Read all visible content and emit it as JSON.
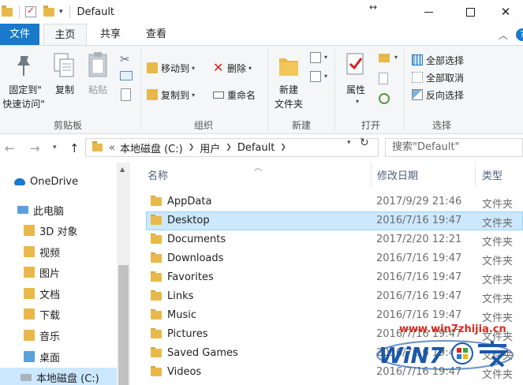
{
  "window": {
    "title": "Default",
    "resize_glyph": "↔",
    "close_glyph": "✕"
  },
  "tabs": {
    "file": "文件",
    "home": "主页",
    "share": "共享",
    "view": "查看",
    "collapse_glyph": "︿",
    "help": "?"
  },
  "ribbon": {
    "clipboard": {
      "label": "剪贴板",
      "pin_line1": "固定到\"",
      "pin_line2": "快速访问\"",
      "copy": "复制",
      "paste": "粘贴"
    },
    "organize": {
      "label": "组织",
      "move_to": "移动到",
      "copy_to": "复制到",
      "delete": "删除",
      "rename": "重命名"
    },
    "new": {
      "label": "新建",
      "new_folder_line1": "新建",
      "new_folder_line2": "文件夹"
    },
    "open": {
      "label": "打开",
      "properties": "属性"
    },
    "select": {
      "label": "选择",
      "select_all": "全部选择",
      "select_none": "全部取消",
      "invert": "反向选择"
    }
  },
  "address": {
    "prefix": "«",
    "crumbs": [
      "本地磁盘 (C:)",
      "用户",
      "Default"
    ],
    "search_placeholder": "搜索\"Default\""
  },
  "nav": {
    "items": [
      {
        "label": "OneDrive",
        "icon": "cloud-icon"
      },
      {
        "label": "此电脑",
        "icon": "computer-icon"
      },
      {
        "label": "3D 对象",
        "icon": "3d-objects-icon"
      },
      {
        "label": "视频",
        "icon": "video-icon"
      },
      {
        "label": "图片",
        "icon": "pictures-icon"
      },
      {
        "label": "文档",
        "icon": "documents-icon"
      },
      {
        "label": "下载",
        "icon": "download-icon"
      },
      {
        "label": "音乐",
        "icon": "music-icon"
      },
      {
        "label": "桌面",
        "icon": "desktop-icon"
      },
      {
        "label": "本地磁盘 (C:)",
        "icon": "drive-icon"
      }
    ]
  },
  "columns": {
    "name": "名称",
    "date": "修改日期",
    "type": "类型"
  },
  "files": [
    {
      "name": "AppData",
      "date": "2017/9/29 21:46",
      "type": "文件夹"
    },
    {
      "name": "Desktop",
      "date": "2016/7/16 19:47",
      "type": "文件夹"
    },
    {
      "name": "Documents",
      "date": "2017/2/20 12:21",
      "type": "文件夹"
    },
    {
      "name": "Downloads",
      "date": "2016/7/16 19:47",
      "type": "文件夹"
    },
    {
      "name": "Favorites",
      "date": "2016/7/16 19:47",
      "type": "文件夹"
    },
    {
      "name": "Links",
      "date": "2016/7/16 19:47",
      "type": "文件夹"
    },
    {
      "name": "Music",
      "date": "2016/7/16 19:47",
      "type": "文件夹"
    },
    {
      "name": "Pictures",
      "date": "2016/7/16 19:47",
      "type": "文件夹"
    },
    {
      "name": "Saved Games",
      "date": "2016/7/16 19:47",
      "type": "文件夹"
    },
    {
      "name": "Videos",
      "date": "2016/7/16 19:47",
      "type": "文件夹"
    }
  ],
  "watermark": {
    "url": "www.win7zhijia.cn"
  },
  "colors": {
    "accent": "#1979ca",
    "selection": "#cce8ff",
    "folder": "#e8b94a"
  }
}
